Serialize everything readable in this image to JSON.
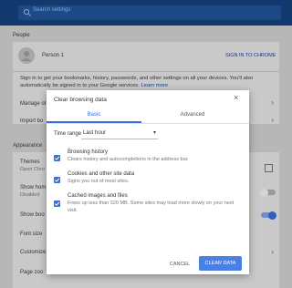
{
  "search": {
    "placeholder": "Search settings"
  },
  "people": {
    "section_title": "People",
    "person_name": "Person 1",
    "sign_in_label": "SIGN IN TO CHROME",
    "sync_text_1": "Sign in to get your bookmarks, history, passwords, and other settings on all your devices. You'll also",
    "sync_text_2": "automatically be signed in to your Google services.",
    "learn_more": "Learn more",
    "manage_label": "Manage ot",
    "import_label": "Import bo"
  },
  "appearance": {
    "section_title": "Appearance",
    "themes_label": "Themes",
    "themes_sub": "Open Chro",
    "show_home_label": "Show hom",
    "show_home_sub": "Disabled",
    "show_bookmarks_label": "Show boo",
    "font_size_label": "Font size",
    "customize_label": "Customize",
    "page_zoom_label": "Page zoo"
  },
  "dialog": {
    "title": "Clear browsing data",
    "tabs": [
      "Basic",
      "Advanced"
    ],
    "time_range_label": "Time range",
    "time_range_value": "Last hour",
    "options": [
      {
        "title": "Browsing history",
        "desc": "Clears history and autocompletions in the address bar.",
        "checked": true
      },
      {
        "title": "Cookies and other site data",
        "desc": "Signs you out of most sites.",
        "checked": true
      },
      {
        "title": "Cached images and files",
        "desc": "Frees up less than 320 MB. Some sites may load more slowly on your next visit.",
        "checked": true
      }
    ],
    "cancel_label": "CANCEL",
    "clear_label": "CLEAR DATA"
  },
  "colors": {
    "accent": "#3a6fd8",
    "button": "#4a80e6",
    "topbar": "#14396f"
  }
}
